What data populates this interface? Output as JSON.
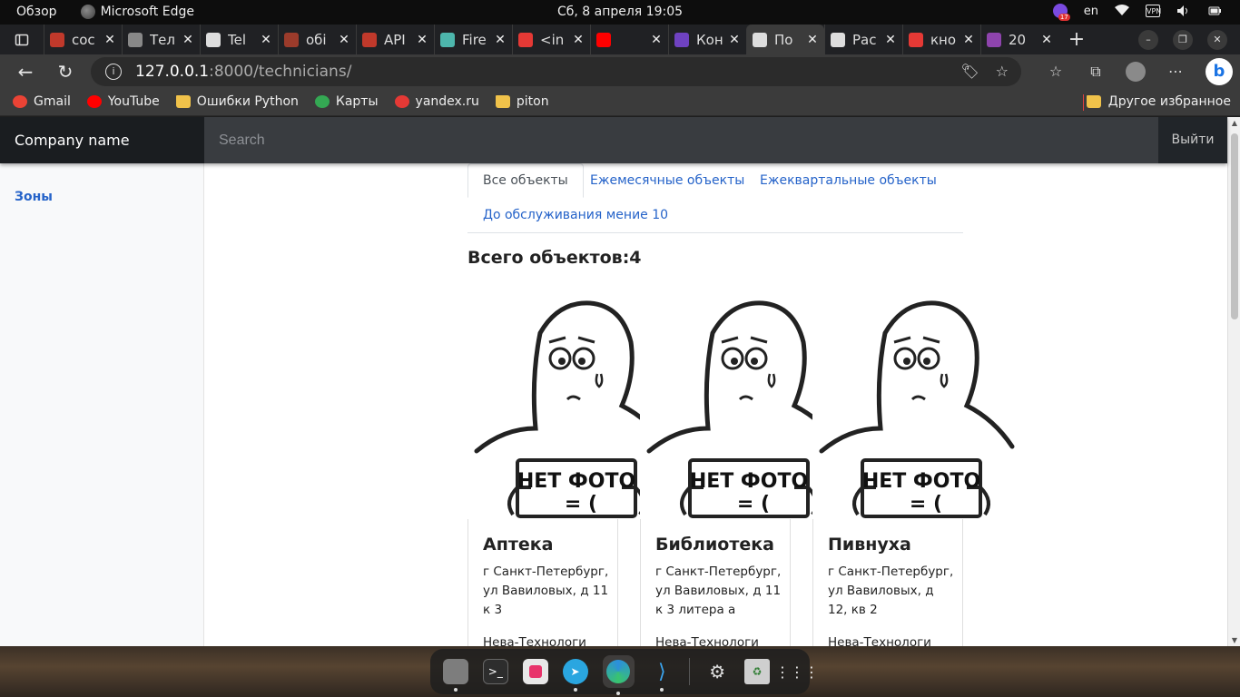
{
  "os_topbar": {
    "overview": "Обзор",
    "app_name": "Microsoft Edge",
    "datetime": "Сб, 8 апреля  19:05",
    "notification_count": "17",
    "language": "en",
    "vpn": "VPN"
  },
  "tabs": [
    {
      "title": "сос",
      "color": "#c0392b"
    },
    {
      "title": "Тел",
      "color": "#888888"
    },
    {
      "title": "Tel",
      "color": "#dddddd"
    },
    {
      "title": "обі",
      "color": "#9b3b2b"
    },
    {
      "title": "API",
      "color": "#c0392b"
    },
    {
      "title": "Fire",
      "color": "#4db6ac"
    },
    {
      "title": "<in",
      "color": "#e53935"
    },
    {
      "title": "",
      "color": "#ff0000"
    },
    {
      "title": "Кон",
      "color": "#6f42c1"
    },
    {
      "title": "По",
      "color": "#dddddd"
    },
    {
      "title": "Рас",
      "color": "#dddddd"
    },
    {
      "title": "кно",
      "color": "#e53935"
    },
    {
      "title": "20",
      "color": "#8e44ad"
    }
  ],
  "address": {
    "host": "127.0.0.1",
    "rest": ":8000/technicians/"
  },
  "bookmarks": [
    {
      "label": "Gmail",
      "color": "#ea4335"
    },
    {
      "label": "YouTube",
      "color": "#ff0000"
    },
    {
      "label": "Ошибки Python",
      "color": "#f0c24a"
    },
    {
      "label": "Карты",
      "color": "#34a853"
    },
    {
      "label": "yandex.ru",
      "color": "#e53935"
    },
    {
      "label": "piton",
      "color": "#f0c24a"
    }
  ],
  "other_bookmarks": "Другое избранное",
  "app": {
    "brand": "Company name",
    "search_placeholder": "Search",
    "signout": "Выйти",
    "sidebar_link": "Зоны",
    "nav_tabs": [
      "Все объекты",
      "Ежемесячные объекты",
      "Ежеквартальные объекты",
      "До обслуживания мение 10"
    ],
    "active_tab": "Все объекты",
    "total": "Всего объектов:4",
    "no_photo_line1": "НЕТ ФОТО",
    "no_photo_line2": "= (",
    "cards": [
      {
        "name": "Аптека",
        "address": "г Санкт-Петербург, ул Вавиловых, д 11 к 3",
        "org": "Нева-Технологи"
      },
      {
        "name": "Библиотека",
        "address": "г Санкт-Петербург, ул Вавиловых, д 11 к 3 литера а",
        "org": "Нева-Технологи"
      },
      {
        "name": "Пивнуха",
        "address": "г Санкт-Петербург, ул Вавиловых, д 12, кв 2",
        "org": "Нева-Технологи"
      }
    ]
  },
  "dock_apps": [
    "files",
    "terminal",
    "software-center",
    "telegram",
    "edge",
    "vscode",
    "settings",
    "trash",
    "app-grid"
  ]
}
